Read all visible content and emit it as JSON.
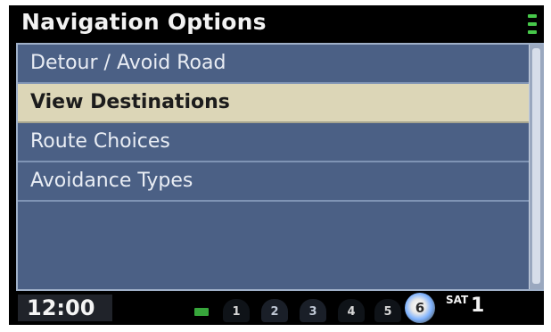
{
  "title": "Navigation Options",
  "menu": {
    "items": [
      {
        "label": "Detour / Avoid Road",
        "selected": false
      },
      {
        "label": "View Destinations",
        "selected": true
      },
      {
        "label": "Route Choices",
        "selected": false
      },
      {
        "label": "Avoidance Types",
        "selected": false
      }
    ]
  },
  "status": {
    "time": "12:00",
    "presets": [
      "1",
      "2",
      "3",
      "4",
      "5"
    ],
    "disc": "6",
    "source": "SAT",
    "channel": "1"
  },
  "colors": {
    "panel": "#4b6085",
    "selected_row": "#dcd6b7",
    "background": "#000000"
  }
}
